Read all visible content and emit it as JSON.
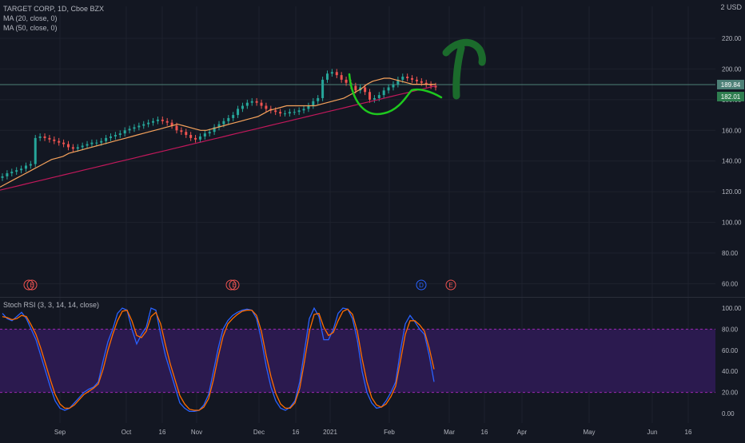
{
  "header": {
    "title": "TARGET CORP, 1D, Cboe BZX",
    "ma20_label": "MA (20, close, 0)",
    "ma50_label": "MA (50, close, 0)",
    "rsi_label": "Stoch RSI (3, 3, 14, 14, close)",
    "currency": "USD",
    "top_tick": "2"
  },
  "colors": {
    "background": "#131722",
    "grid": "#1e222d",
    "text": "#b2b5be",
    "up_candle": "#26a69a",
    "down_candle": "#ef5350",
    "candle_neutral": "#b2b5be",
    "ma20": "#f7a35c",
    "ma50": "#c2185b",
    "stoch_k": "#2962ff",
    "stoch_d": "#ff6d00",
    "rsi_band_fill": "#2b1a4f",
    "rsi_band_line": "#9c27b0",
    "hline": "#4d8077",
    "drawing_green": "#1ec81e",
    "drawing_dark_green": "#1b6b2c",
    "event_e": "#ef5350",
    "event_d": "#2962ff"
  },
  "chart_data": [
    {
      "type": "candlestick",
      "title": "TARGET CORP, 1D, Cboe BZX",
      "ylabel": "USD",
      "ylim": [
        55,
        240
      ],
      "y_ticks": [
        "60.00",
        "80.00",
        "100.00",
        "120.00",
        "140.00",
        "160.00",
        "180.00",
        "200.00",
        "220.00"
      ],
      "x_ticks": [
        "Sep",
        "Oct",
        "16",
        "Nov",
        "Dec",
        "16",
        "2021",
        "Feb",
        "Mar",
        "16",
        "Apr",
        "May",
        "Jun",
        "16"
      ],
      "last_price_label": "189.84",
      "ma_price_label": "182.01",
      "close_series": [
        130,
        132,
        133,
        134,
        135,
        137,
        138,
        155,
        156,
        155,
        154,
        153,
        152,
        151,
        149,
        148,
        149,
        150,
        151,
        152,
        152,
        153,
        155,
        156,
        157,
        158,
        160,
        161,
        162,
        163,
        164,
        165,
        166,
        167,
        166,
        165,
        163,
        160,
        159,
        157,
        155,
        154,
        156,
        158,
        159,
        162,
        164,
        166,
        168,
        170,
        174,
        176,
        178,
        179,
        178,
        176,
        174,
        173,
        172,
        171,
        171,
        172,
        172,
        173,
        174,
        176,
        179,
        181,
        193,
        197,
        198,
        196,
        193,
        191,
        189,
        186,
        188,
        185,
        180,
        181,
        183,
        186,
        188,
        190,
        193,
        195,
        194,
        193,
        192,
        191,
        190,
        189,
        188
      ],
      "ma20_series": [
        123,
        125,
        127,
        129,
        131,
        133,
        135,
        137,
        139,
        141,
        142,
        143,
        145,
        146,
        147,
        148,
        149,
        150,
        151,
        152,
        153,
        154,
        155,
        156,
        157,
        158,
        159,
        160,
        161,
        162,
        163,
        164,
        163,
        162,
        161,
        160,
        160,
        161,
        162,
        163,
        164,
        165,
        166,
        167,
        168,
        169,
        171,
        173,
        174,
        175,
        176,
        176,
        176,
        176,
        176,
        176,
        177,
        178,
        179,
        180,
        181,
        183,
        185,
        187,
        190,
        192,
        193,
        194,
        194,
        193,
        192,
        191,
        190,
        190,
        190,
        190,
        190
      ],
      "ma50_series": [
        121,
        122,
        123,
        124,
        125,
        126,
        127,
        128,
        129,
        130,
        131,
        132,
        133,
        134,
        135,
        136,
        137,
        138,
        139,
        140,
        141,
        142,
        143,
        144,
        145,
        146,
        147,
        148,
        149,
        150,
        151,
        152,
        153,
        154,
        155,
        156,
        157,
        158,
        159,
        160,
        161,
        162,
        163,
        164,
        165,
        166,
        167,
        168,
        169,
        170,
        171,
        172,
        173,
        174,
        175,
        176,
        177,
        178,
        179,
        180,
        181,
        182,
        183,
        184,
        185,
        186,
        187,
        188,
        189
      ],
      "events": [
        {
          "label": "E",
          "kind": "earnings"
        },
        {
          "label": "E",
          "kind": "earnings"
        },
        {
          "label": "D",
          "kind": "dividend"
        },
        {
          "label": "E",
          "kind": "earnings"
        }
      ]
    },
    {
      "type": "line",
      "title": "Stoch RSI (3, 3, 14, 14, close)",
      "ylim": [
        -8,
        105
      ],
      "y_ticks": [
        "0.00",
        "20.00",
        "40.00",
        "60.00",
        "80.00",
        "100.00"
      ],
      "upper_band": 80,
      "lower_band": 20,
      "series": [
        {
          "values": [
            95,
            90,
            88,
            92,
            96,
            90,
            80,
            70,
            55,
            40,
            25,
            12,
            5,
            3,
            5,
            10,
            15,
            20,
            23,
            25,
            30,
            50,
            68,
            80,
            95,
            100,
            98,
            80,
            66,
            75,
            82,
            100,
            98,
            75,
            55,
            40,
            25,
            10,
            5,
            2,
            2,
            3,
            8,
            18,
            40,
            62,
            80,
            88,
            93,
            96,
            98,
            99,
            98,
            90,
            70,
            45,
            25,
            12,
            5,
            3,
            6,
            12,
            30,
            60,
            90,
            100,
            92,
            70,
            70,
            80,
            95,
            100,
            99,
            90,
            70,
            40,
            20,
            10,
            5,
            6,
            12,
            20,
            30,
            60,
            85,
            93,
            87,
            80,
            75,
            55,
            30
          ]
        },
        {
          "values": [
            92,
            91,
            89,
            90,
            93,
            92,
            84,
            75,
            62,
            47,
            32,
            18,
            9,
            5,
            5,
            8,
            13,
            18,
            21,
            24,
            28,
            42,
            60,
            75,
            88,
            97,
            98,
            88,
            74,
            72,
            78,
            92,
            96,
            85,
            65,
            47,
            32,
            17,
            9,
            4,
            3,
            3,
            6,
            14,
            32,
            54,
            73,
            85,
            90,
            94,
            97,
            98,
            98,
            93,
            78,
            55,
            35,
            19,
            9,
            5,
            5,
            10,
            24,
            50,
            78,
            94,
            95,
            82,
            74,
            77,
            88,
            97,
            99,
            94,
            78,
            52,
            30,
            15,
            8,
            6,
            9,
            16,
            26,
            50,
            75,
            88,
            88,
            84,
            78,
            62,
            42
          ]
        }
      ]
    }
  ]
}
